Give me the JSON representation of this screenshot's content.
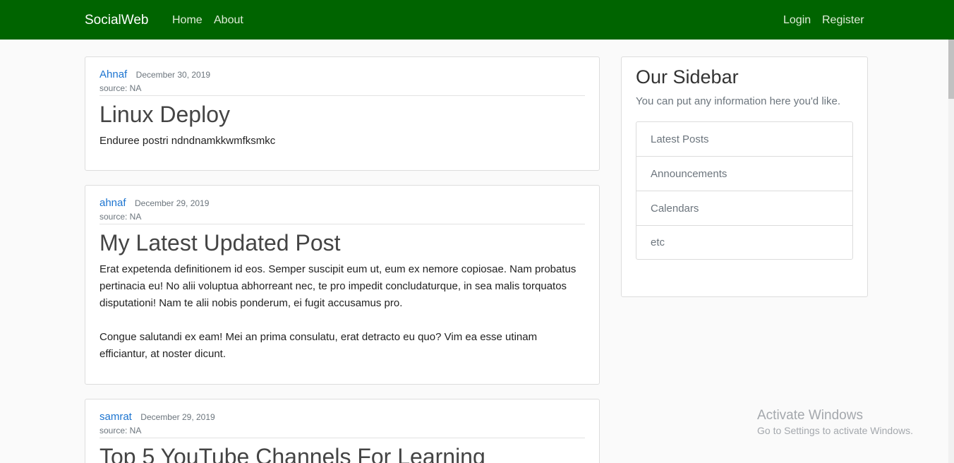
{
  "navbar": {
    "brand": "SocialWeb",
    "links_left": [
      "Home",
      "About"
    ],
    "links_right": [
      "Login",
      "Register"
    ],
    "color": "#006400"
  },
  "posts": [
    {
      "author": "Ahnaf",
      "date": "December 30, 2019",
      "source": "source: NA",
      "title": "Linux Deploy",
      "body": [
        "Enduree postri ndndnamkkwmfksmkc"
      ]
    },
    {
      "author": "ahnaf",
      "date": "December 29, 2019",
      "source": "source: NA",
      "title": "My Latest Updated Post",
      "body": [
        "Erat expetenda definitionem id eos. Semper suscipit eum ut, eum ex nemore copiosae. Nam probatus pertinacia eu! No alii voluptua abhorreant nec, te pro impedit concludaturque, in sea malis torquatos disputationi! Nam te alii nobis ponderum, ei fugit accusamus pro.",
        "Congue salutandi ex eam! Mei an prima consulatu, erat detracto eu quo? Vim ea esse utinam efficiantur, at noster dicunt."
      ]
    },
    {
      "author": "samrat",
      "date": "December 29, 2019",
      "source": "source: NA",
      "title": "Top 5 YouTube Channels For Learning",
      "body": []
    }
  ],
  "sidebar": {
    "title": "Our Sidebar",
    "description": "You can put any information here you'd like.",
    "items": [
      "Latest Posts",
      "Announcements",
      "Calendars",
      "etc"
    ]
  },
  "watermark": {
    "title": "Activate Windows",
    "subtitle": "Go to Settings to activate Windows."
  }
}
